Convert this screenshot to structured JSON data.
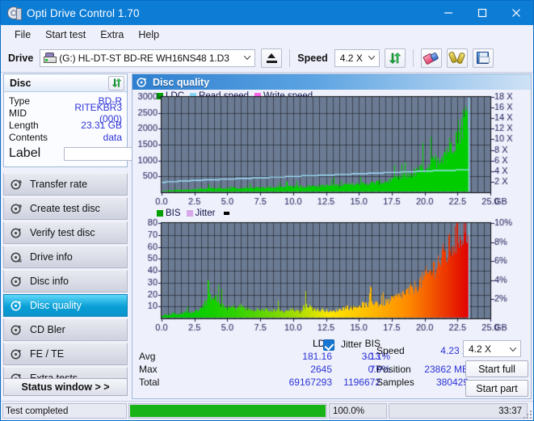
{
  "window": {
    "title": "Opti Drive Control 1.70",
    "icon": "disc-icon",
    "minimize": "minimize-icon",
    "maximize": "maximize-icon",
    "close": "close-icon"
  },
  "menu": {
    "items": [
      "File",
      "Start test",
      "Extra",
      "Help"
    ]
  },
  "toolbar": {
    "drive_label": "Drive",
    "drive_value": "(G:)  HL-DT-ST BD-RE  WH16NS48 1.D3",
    "eject_icon": "eject-icon",
    "speed_label": "Speed",
    "speed_value": "4.2 X",
    "refresh_icon": "refresh-icon",
    "erase_icon": "erase-disc-icon",
    "tools_icon": "tools-icon",
    "save_icon": "save-icon"
  },
  "disc_panel": {
    "title": "Disc",
    "refresh_icon": "refresh-icon",
    "rows": [
      {
        "key": "Type",
        "value": "BD-R"
      },
      {
        "key": "MID",
        "value": "RITEKBR3 (000)"
      },
      {
        "key": "Length",
        "value": "23.31 GB"
      },
      {
        "key": "Contents",
        "value": "data"
      }
    ],
    "label_key": "Label",
    "label_value": "",
    "label_placeholder": "",
    "cd_icon": "cd-icon"
  },
  "sidebar": {
    "items": [
      {
        "label": "Transfer rate",
        "icon": "disc-transfer-icon",
        "active": false
      },
      {
        "label": "Create test disc",
        "icon": "disc-create-icon",
        "active": false
      },
      {
        "label": "Verify test disc",
        "icon": "disc-verify-icon",
        "active": false
      },
      {
        "label": "Drive info",
        "icon": "disc-drive-icon",
        "active": false
      },
      {
        "label": "Disc info",
        "icon": "disc-info-icon",
        "active": false
      },
      {
        "label": "Disc quality",
        "icon": "disc-quality-icon",
        "active": true
      },
      {
        "label": "CD Bler",
        "icon": "disc-bler-icon",
        "active": false
      },
      {
        "label": "FE / TE",
        "icon": "disc-fete-icon",
        "active": false
      },
      {
        "label": "Extra tests",
        "icon": "disc-extra-icon",
        "active": false
      }
    ],
    "status_window_button": "Status window > >"
  },
  "content": {
    "header_title": "Disc quality",
    "header_icon": "disc-quality-icon"
  },
  "stats": {
    "col_ldc": "LDC",
    "col_bis": "BIS",
    "row_avg": "Avg",
    "row_max": "Max",
    "row_total": "Total",
    "ldc_avg": "181.16",
    "ldc_max": "2645",
    "ldc_total": "69167293",
    "bis_avg": "3.13",
    "bis_max": "77",
    "bis_total": "1196672",
    "jitter_label": "Jitter",
    "jitter_checked": true,
    "jitter_avg": "-0.1%",
    "jitter_max": "0.0%",
    "speed_label": "Speed",
    "speed_value": "4.23 X",
    "position_label": "Position",
    "position_value": "23862 MB",
    "samples_label": "Samples",
    "samples_value": "380429",
    "speed_select": "4.2 X",
    "start_full": "Start full",
    "start_part": "Start part"
  },
  "statusbar": {
    "message": "Test completed",
    "progress_percent": "100.0%",
    "progress_value": 100,
    "elapsed": "33:37"
  },
  "chart_data": [
    {
      "type": "area",
      "id": "ldc-chart",
      "title": "",
      "xlabel": "GB",
      "ylabel": "",
      "xlim": [
        0,
        25.0
      ],
      "ylim": [
        0,
        3000
      ],
      "xticks": [
        "0.0",
        "2.5",
        "5.0",
        "7.5",
        "10.0",
        "12.5",
        "15.0",
        "17.5",
        "20.0",
        "22.5",
        "25.0"
      ],
      "yticks": [
        500,
        1000,
        1500,
        2000,
        2500,
        3000
      ],
      "y2lim": [
        0,
        18
      ],
      "y2ticks": [
        "2 X",
        "4 X",
        "6 X",
        "8 X",
        "10 X",
        "12 X",
        "14 X",
        "16 X",
        "18 X"
      ],
      "grid": true,
      "legend_position": "top-left",
      "legend": [
        {
          "name": "LDC",
          "color": "#00b400"
        },
        {
          "name": "Read speed",
          "color": "#7fd4f7"
        },
        {
          "name": "Write speed",
          "color": "#ff6ee0"
        }
      ],
      "series": [
        {
          "name": "LDC",
          "color": "#00cc00",
          "x": [
            0.0,
            0.3,
            0.6,
            0.9,
            1.2,
            1.5,
            1.8,
            2.1,
            2.4,
            2.7,
            3.0,
            3.3,
            3.6,
            3.9,
            4.2,
            4.5,
            4.8,
            5.1,
            5.4,
            5.7,
            6.0,
            6.3,
            6.6,
            6.9,
            7.2,
            7.5,
            7.8,
            8.1,
            8.4,
            8.7,
            9.0,
            9.3,
            9.6,
            9.9,
            10.2,
            10.5,
            10.8,
            11.1,
            11.4,
            11.7,
            12.0,
            12.3,
            12.6,
            12.9,
            13.2,
            13.5,
            13.8,
            14.1,
            14.4,
            14.7,
            15.0,
            15.3,
            15.6,
            15.9,
            16.2,
            16.5,
            16.8,
            17.1,
            17.4,
            17.7,
            18.0,
            18.3,
            18.6,
            18.9,
            19.2,
            19.5,
            19.8,
            20.1,
            20.4,
            20.7,
            21.0,
            21.3,
            21.6,
            21.9,
            22.2,
            22.5,
            22.8,
            23.1,
            23.3,
            23.4
          ],
          "values": [
            20,
            45,
            60,
            55,
            70,
            65,
            80,
            75,
            90,
            85,
            120,
            110,
            130,
            125,
            115,
            105,
            120,
            110,
            130,
            120,
            115,
            125,
            135,
            120,
            130,
            125,
            140,
            150,
            145,
            135,
            150,
            160,
            155,
            165,
            160,
            170,
            165,
            180,
            175,
            190,
            185,
            195,
            190,
            200,
            210,
            205,
            215,
            225,
            220,
            235,
            245,
            240,
            260,
            255,
            275,
            290,
            300,
            320,
            345,
            370,
            400,
            440,
            480,
            520,
            570,
            620,
            680,
            740,
            810,
            890,
            980,
            1090,
            1210,
            1350,
            1520,
            1720,
            1960,
            2230,
            2450,
            0
          ]
        },
        {
          "name": "Read speed",
          "color": "#9fe2fb",
          "x": [
            0.0,
            1.5,
            3.0,
            4.5,
            6.0,
            7.5,
            9.0,
            10.5,
            12.0,
            13.5,
            15.0,
            16.5,
            18.0,
            19.5,
            21.0,
            22.5,
            23.3,
            23.35
          ],
          "values": [
            1.9,
            2.1,
            2.3,
            2.45,
            2.6,
            2.75,
            2.9,
            3.05,
            3.2,
            3.35,
            3.5,
            3.65,
            3.8,
            3.95,
            4.1,
            4.2,
            4.25,
            18.0
          ]
        }
      ]
    },
    {
      "type": "area",
      "id": "bis-chart",
      "title": "",
      "xlabel": "GB",
      "ylabel": "",
      "xlim": [
        0,
        25.0
      ],
      "ylim": [
        0,
        80
      ],
      "xticks": [
        "0.0",
        "2.5",
        "5.0",
        "7.5",
        "10.0",
        "12.5",
        "15.0",
        "17.5",
        "20.0",
        "22.5",
        "25.0"
      ],
      "yticks": [
        10,
        20,
        30,
        40,
        50,
        60,
        70,
        80
      ],
      "y2lim": [
        0,
        10
      ],
      "y2ticks": [
        "2%",
        "4%",
        "6%",
        "8%",
        "10%"
      ],
      "grid": true,
      "legend_position": "top-left",
      "legend": [
        {
          "name": "BIS",
          "color": "#00b400"
        },
        {
          "name": "Jitter",
          "color": "#d9a8e8"
        }
      ],
      "series": [
        {
          "name": "BIS",
          "color_scale": [
            "#00cc00",
            "#ffe600",
            "#ff8c00",
            "#e00000"
          ],
          "x": [
            0.0,
            0.3,
            0.6,
            0.9,
            1.2,
            1.5,
            1.8,
            2.1,
            2.4,
            2.7,
            3.0,
            3.3,
            3.6,
            3.9,
            4.2,
            4.5,
            4.8,
            5.1,
            5.4,
            5.7,
            6.0,
            6.3,
            6.6,
            6.9,
            7.2,
            7.5,
            7.8,
            8.1,
            8.4,
            8.7,
            9.0,
            9.3,
            9.6,
            9.9,
            10.2,
            10.5,
            10.8,
            11.1,
            11.4,
            11.7,
            12.0,
            12.3,
            12.6,
            12.9,
            13.2,
            13.5,
            13.8,
            14.1,
            14.4,
            14.7,
            15.0,
            15.3,
            15.6,
            15.9,
            16.2,
            16.5,
            16.8,
            17.1,
            17.4,
            17.7,
            18.0,
            18.3,
            18.6,
            18.9,
            19.2,
            19.5,
            19.8,
            20.1,
            20.4,
            20.7,
            21.0,
            21.3,
            21.6,
            21.9,
            22.2,
            22.5,
            22.8,
            23.1,
            23.3
          ],
          "values": [
            2,
            3,
            3,
            4,
            3,
            4,
            5,
            4,
            5,
            6,
            9,
            12,
            16,
            19,
            14,
            11,
            9,
            8,
            9,
            8,
            10,
            8,
            7,
            6,
            7,
            6,
            7,
            6,
            6,
            7,
            6,
            5,
            6,
            7,
            6,
            5,
            9,
            11,
            8,
            7,
            6,
            7,
            6,
            5,
            6,
            7,
            8,
            9,
            8,
            9,
            10,
            11,
            10,
            12,
            13,
            11,
            12,
            13,
            14,
            16,
            17,
            19,
            20,
            22,
            24,
            27,
            30,
            33,
            36,
            40,
            44,
            47,
            50,
            55,
            60,
            64,
            68,
            72,
            71
          ]
        },
        {
          "name": "Jitter",
          "color": "#9fe2fb",
          "x": [
            23.3,
            23.35
          ],
          "values": [
            9.9,
            10.0
          ]
        }
      ]
    }
  ]
}
